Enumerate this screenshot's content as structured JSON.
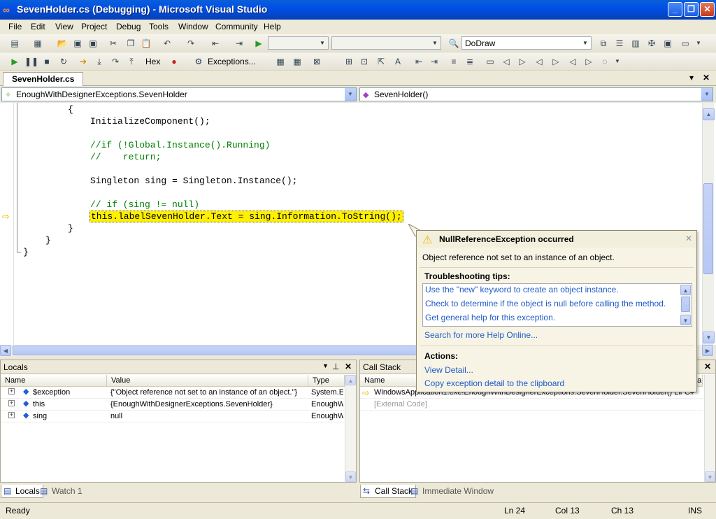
{
  "window": {
    "title": "SevenHolder.cs (Debugging) - Microsoft Visual Studio",
    "minimize": "_",
    "restore": "❐",
    "close": "✕"
  },
  "menu": [
    "File",
    "Edit",
    "View",
    "Project",
    "Debug",
    "Tools",
    "Window",
    "Community",
    "Help"
  ],
  "toolbar1": {
    "solution_config": "",
    "solution_platform": "",
    "find_combo": "DoDraw"
  },
  "toolbar2": {
    "hex_label": "Hex",
    "exceptions_label": "Exceptions..."
  },
  "doc_tab": {
    "label": "SevenHolder.cs",
    "dropdown": "▾",
    "close": "✕"
  },
  "navbar": {
    "type_combo": "EnoughWithDesignerExceptions.SevenHolder",
    "member_combo": "SevenHolder()"
  },
  "code_lines": [
    {
      "text": "{",
      "kind": "plain"
    },
    {
      "text": "InitializeComponent();",
      "kind": "plain"
    },
    {
      "text": "//if (!Global.Instance().Running)",
      "kind": "comment"
    },
    {
      "text": "//    return;",
      "kind": "comment"
    },
    {
      "text": "Singleton sing = Singleton.Instance();",
      "kind": "plain"
    },
    {
      "text": "// if (sing != null)",
      "kind": "comment"
    },
    {
      "text": "this.labelSevenHolder.Text = sing.Information.ToString();",
      "kind": "current"
    },
    {
      "text": "}",
      "kind": "plain"
    },
    {
      "text": "}",
      "kind": "plain"
    },
    {
      "text": "}",
      "kind": "plain"
    }
  ],
  "exception": {
    "title": "NullReferenceException occurred",
    "message": "Object reference not set to an instance of an object.",
    "tips_heading": "Troubleshooting tips:",
    "tips": [
      "Use the \"new\" keyword to create an object instance.",
      "Check to determine if the object is null before calling the method.",
      "Get general help for this exception."
    ],
    "search_link": "Search for more Help Online...",
    "actions_heading": "Actions:",
    "actions": [
      "View Detail...",
      "Copy exception detail to the clipboard"
    ]
  },
  "locals": {
    "title": "Locals",
    "columns": [
      "Name",
      "Value",
      "Type"
    ],
    "rows": [
      {
        "name": "$exception",
        "value": "{\"Object reference not set to an instance of an object.\"}",
        "type": "System.E"
      },
      {
        "name": "this",
        "value": "{EnoughWithDesignerExceptions.SevenHolder}",
        "type": "EnoughW"
      },
      {
        "name": "sing",
        "value": "null",
        "type": "EnoughW"
      }
    ],
    "tabs": [
      "Locals",
      "Watch 1"
    ]
  },
  "callstack": {
    "title": "Call Stack",
    "columns": [
      "Name",
      "Lang"
    ],
    "rows": [
      "WindowsApplication1.exe!EnoughWithDesignerExceptions.SevenHolder.SevenHolder() Line",
      "[External Code]"
    ],
    "lang_cell": "C#",
    "tabs": [
      "Call Stack",
      "Immediate Window"
    ]
  },
  "status": {
    "text": "Ready",
    "ln": "Ln 24",
    "col": "Col 13",
    "ch": "Ch 13",
    "mode": "INS"
  },
  "colors": {
    "titlebar": "#0050e6",
    "current_line": "#ffef00",
    "comment": "#008000",
    "link": "#1f5bc7"
  }
}
